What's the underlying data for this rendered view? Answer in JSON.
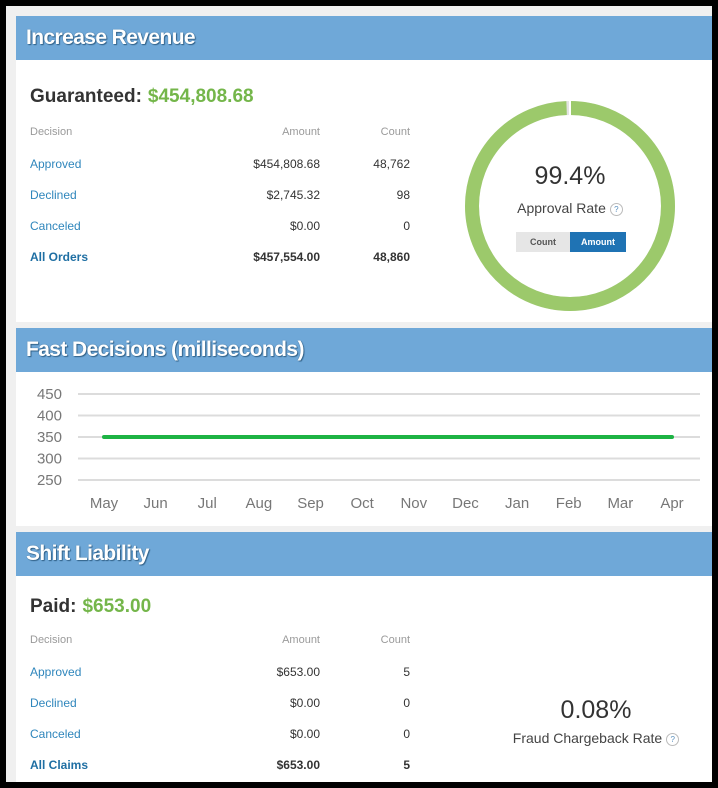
{
  "revenue": {
    "title": "Increase Revenue",
    "guaranteed_label": "Guaranteed:",
    "guaranteed_value": "$454,808.68",
    "headers": {
      "decision": "Decision",
      "amount": "Amount",
      "count": "Count"
    },
    "rows": [
      {
        "decision": "Approved",
        "amount": "$454,808.68",
        "count": "48,762"
      },
      {
        "decision": "Declined",
        "amount": "$2,745.32",
        "count": "98"
      },
      {
        "decision": "Canceled",
        "amount": "$0.00",
        "count": "0"
      },
      {
        "decision": "All Orders",
        "amount": "$457,554.00",
        "count": "48,860"
      }
    ],
    "approval_pct": "99.4%",
    "approval_fraction": 0.994,
    "approval_label": "Approval Rate",
    "help_glyph": "?",
    "toggle": {
      "count": "Count",
      "amount": "Amount",
      "selected": "Amount"
    },
    "colors": {
      "ring": "#9cc96b",
      "accent": "#74b64a"
    }
  },
  "decisions": {
    "title": "Fast Decisions (milliseconds)",
    "chart_data": {
      "type": "line",
      "categories": [
        "May",
        "Jun",
        "Jul",
        "Aug",
        "Sep",
        "Oct",
        "Nov",
        "Dec",
        "Jan",
        "Feb",
        "Mar",
        "Apr"
      ],
      "series": [
        {
          "values": [
            350,
            350,
            350,
            350,
            350,
            350,
            350,
            350,
            350,
            350,
            350,
            350
          ],
          "color": "#1db344"
        }
      ],
      "yticks": [
        450,
        400,
        350,
        300,
        250
      ],
      "ylim": [
        250,
        450
      ],
      "grid": true,
      "title": "",
      "xlabel": "",
      "ylabel": ""
    }
  },
  "liability": {
    "title": "Shift Liability",
    "paid_label": "Paid:",
    "paid_value": "$653.00",
    "headers": {
      "decision": "Decision",
      "amount": "Amount",
      "count": "Count"
    },
    "rows": [
      {
        "decision": "Approved",
        "amount": "$653.00",
        "count": "5"
      },
      {
        "decision": "Declined",
        "amount": "$0.00",
        "count": "0"
      },
      {
        "decision": "Canceled",
        "amount": "$0.00",
        "count": "0"
      },
      {
        "decision": "All Claims",
        "amount": "$653.00",
        "count": "5"
      }
    ],
    "fraud_pct": "0.08%",
    "fraud_label": "Fraud Chargeback Rate",
    "help_glyph": "?"
  }
}
